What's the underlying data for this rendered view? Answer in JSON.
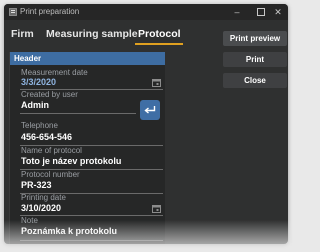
{
  "window": {
    "title": "Print preparation"
  },
  "tabs": [
    {
      "label": "Firm"
    },
    {
      "label": "Measuring sample"
    },
    {
      "label": "Protocol",
      "active": true
    }
  ],
  "accent_color": "#e0a020",
  "header_color": "#3e6da2",
  "panel": {
    "title": "Header",
    "fields": [
      {
        "label": "Measurement date",
        "value": "3/3/2020",
        "icon": "calendar-icon"
      },
      {
        "label": "Created by user",
        "value": "Admin",
        "icon": "enter-icon"
      },
      {
        "label": "Telephone",
        "value": "456-654-546"
      },
      {
        "label": "Name of protocol",
        "value": "Toto je název protokolu"
      },
      {
        "label": "Protocol number",
        "value": "PR-323"
      },
      {
        "label": "Printing date",
        "value": "3/10/2020",
        "icon": "calendar-icon"
      },
      {
        "label": "Note",
        "value": "Poznámka k protokolu"
      }
    ]
  },
  "actions": {
    "print_preview": "Print preview",
    "print": "Print",
    "close": "Close"
  }
}
